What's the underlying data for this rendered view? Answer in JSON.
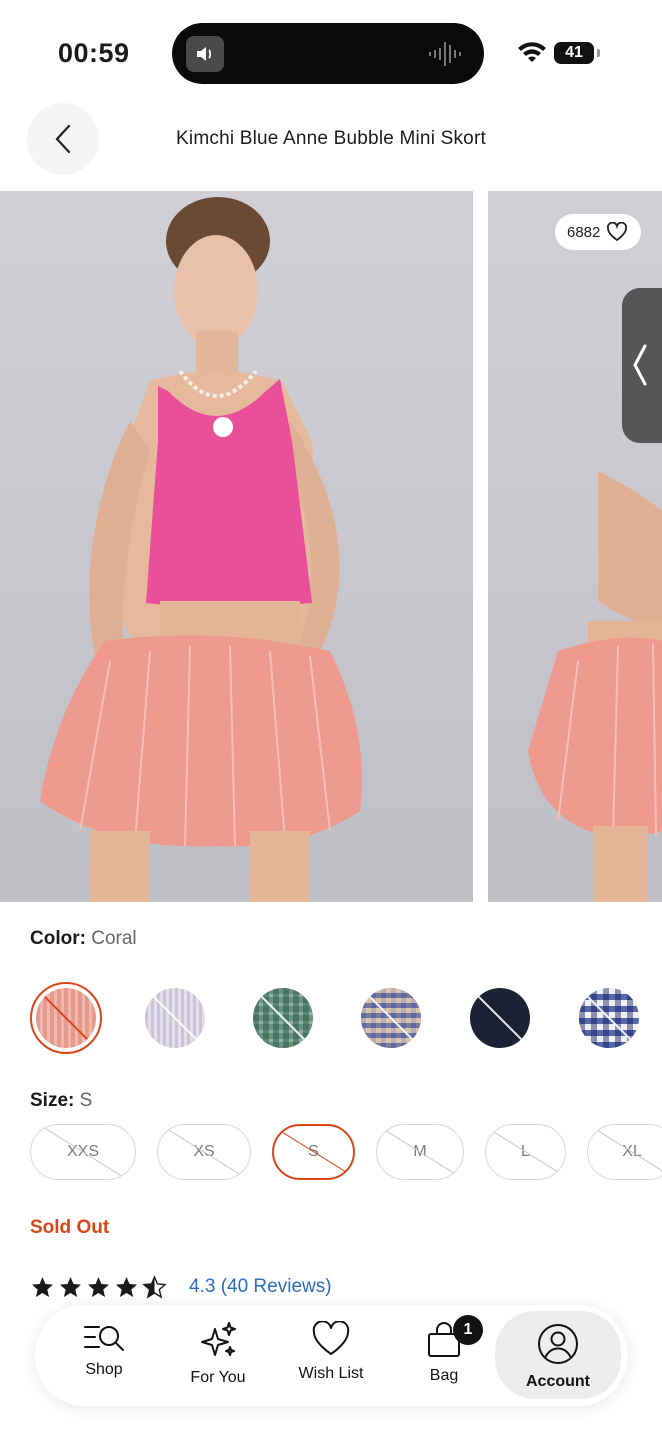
{
  "status_bar": {
    "time": "00:59",
    "battery": "41"
  },
  "header": {
    "title": "Kimchi Blue Anne Bubble Mini Skort"
  },
  "gallery": {
    "likes": "6882"
  },
  "color": {
    "label": "Color:",
    "selected": "Coral",
    "swatches": [
      {
        "name": "coral",
        "hex": "#e7a89a"
      },
      {
        "name": "lavender-stripe",
        "hex": "#cdc6d8"
      },
      {
        "name": "green-plaid",
        "hex": "#8fb3a6"
      },
      {
        "name": "blue-orange-plaid",
        "hex": "#a7a4b6"
      },
      {
        "name": "navy",
        "hex": "#1c2233"
      },
      {
        "name": "blue-plaid",
        "hex": "#5a6fb0"
      }
    ]
  },
  "size": {
    "label": "Size:",
    "selected": "S",
    "options": [
      "XXS",
      "XS",
      "S",
      "M",
      "L",
      "XL"
    ]
  },
  "availability": "Sold Out",
  "rating": {
    "value": 4.3,
    "text": "4.3 (40 Reviews)"
  },
  "nav": {
    "items": [
      {
        "label": "Shop",
        "icon": "shop-search-icon"
      },
      {
        "label": "For You",
        "icon": "sparkles-icon"
      },
      {
        "label": "Wish List",
        "icon": "heart-icon"
      },
      {
        "label": "Bag",
        "icon": "bag-icon",
        "badge": "1"
      },
      {
        "label": "Account",
        "icon": "account-icon",
        "active": true
      }
    ]
  },
  "colors": {
    "accent": "#d9461a",
    "link": "#2a6ebd"
  }
}
